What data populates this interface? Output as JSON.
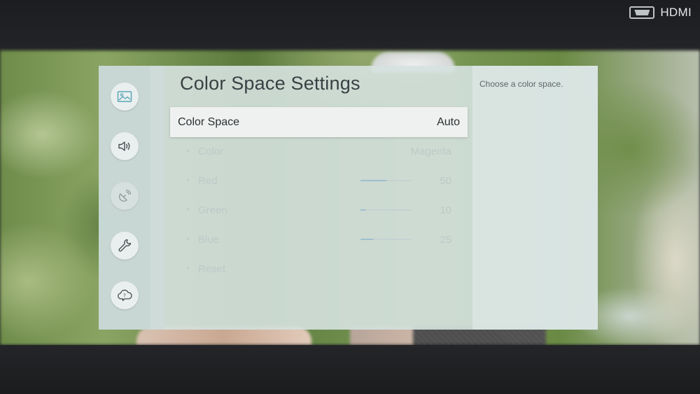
{
  "status": {
    "input_label": "HDMI",
    "input_icon": "hdmi-icon"
  },
  "sidebar": {
    "items": [
      {
        "icon": "picture-icon",
        "dim": false
      },
      {
        "icon": "sound-icon",
        "dim": false
      },
      {
        "icon": "broadcast-icon",
        "dim": true
      },
      {
        "icon": "wrench-icon",
        "dim": false
      },
      {
        "icon": "support-icon",
        "dim": false
      }
    ]
  },
  "main": {
    "title": "Color Space Settings",
    "selected": {
      "label": "Color Space",
      "value": "Auto"
    },
    "sub_items": [
      {
        "label": "Color",
        "value": "Magenta",
        "level": null
      },
      {
        "label": "Red",
        "value": "50",
        "level": 0.5
      },
      {
        "label": "Green",
        "value": "10",
        "level": 0.1
      },
      {
        "label": "Blue",
        "value": "25",
        "level": 0.25
      },
      {
        "label": "Reset",
        "value": "",
        "level": null
      }
    ]
  },
  "help": {
    "text": "Choose a color space."
  },
  "colors": {
    "panel": "#d6e2e0",
    "selected_row": "#eef1f0",
    "disabled_text": "#bccac9"
  }
}
